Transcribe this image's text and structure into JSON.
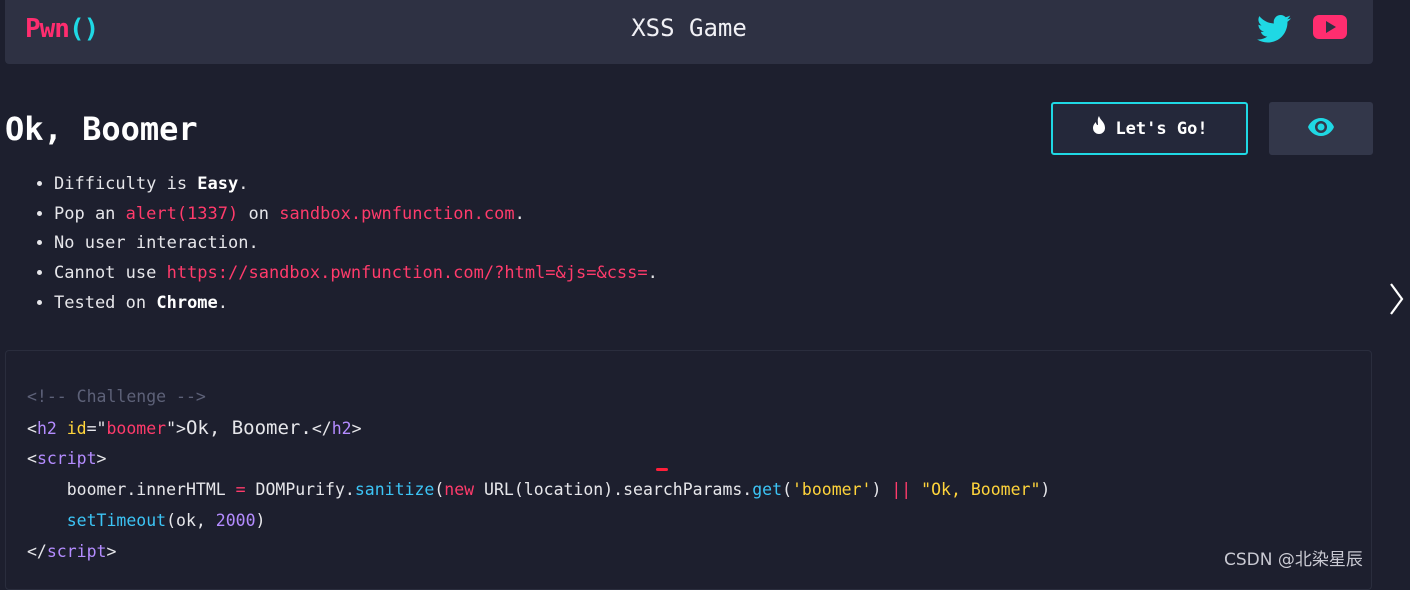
{
  "header": {
    "logo_main": "Pwn",
    "logo_parens": "()",
    "title": "XSS Game",
    "icons": [
      "twitter-icon",
      "youtube-icon"
    ]
  },
  "challenge": {
    "title": "Ok, Boomer",
    "go_label": "Let's Go!",
    "rules": {
      "difficulty_prefix": "Difficulty is ",
      "difficulty_value": "Easy",
      "difficulty_suffix": ".",
      "pop_prefix": "Pop an ",
      "pop_code": "alert(1337)",
      "pop_mid": " on ",
      "pop_host": "sandbox.pwnfunction.com",
      "pop_suffix": ".",
      "no_interaction": "No user interaction.",
      "cannot_prefix": "Cannot use ",
      "cannot_url": "https://sandbox.pwnfunction.com/?html=&js=&css=",
      "cannot_suffix": ".",
      "tested_prefix": "Tested on ",
      "tested_value": "Chrome",
      "tested_suffix": "."
    }
  },
  "code": {
    "comment": "<!-- Challenge -->",
    "h2_id_value": "boomer",
    "h2_text": "Ok, Boomer.",
    "line3_obj": "boomer.innerHTML ",
    "line3_eq": "=",
    "line3_dp": " DOMPurify.",
    "line3_sanitize": "sanitize",
    "line3_open": "(",
    "line3_new": "new",
    "line3_url": " URL(location).searchParams.",
    "line3_get": "get",
    "line3_arg": "'boomer'",
    "line3_or": "||",
    "line3_default": "\"Ok, Boomer\"",
    "line4_fn": "setTimeout",
    "line4_args": "(ok, ",
    "line4_num": "2000",
    "line4_close": ")"
  },
  "watermark": "CSDN @北染星辰",
  "colors": {
    "background": "#1d1f2e",
    "header": "#2e3143",
    "accent_pink": "#ff2d6f",
    "accent_cyan": "#1fd8e4"
  }
}
